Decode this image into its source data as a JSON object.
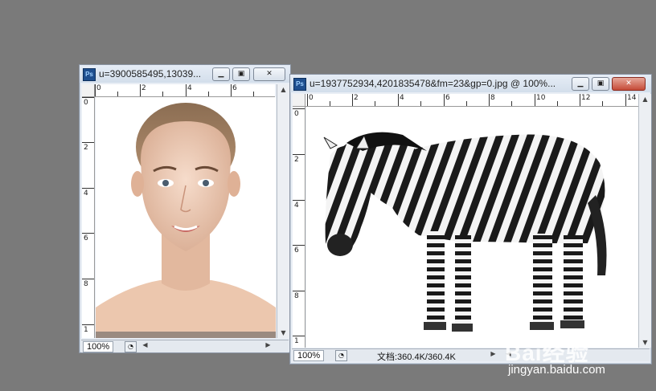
{
  "app": "Photoshop",
  "windows": [
    {
      "icon_label": "Ps",
      "title": "u=3900585495,13039...",
      "zoom": "100%",
      "ruler_h_labels": [
        "0",
        "2",
        "4",
        "6"
      ],
      "ruler_v_labels": [
        "0",
        "2",
        "4",
        "6",
        "8",
        "1"
      ],
      "image_subject": "woman-portrait"
    },
    {
      "icon_label": "Ps",
      "title": "u=1937752934,4201835478&fm=23&gp=0.jpg @ 100%...",
      "zoom": "100%",
      "doc_info": "文档:360.4K/360.4K",
      "ruler_h_labels": [
        "0",
        "2",
        "4",
        "6",
        "8",
        "10",
        "12",
        "14"
      ],
      "ruler_v_labels": [
        "0",
        "2",
        "4",
        "6",
        "8",
        "1"
      ],
      "image_subject": "zebra"
    }
  ],
  "watermark": {
    "brand": "Bai经验",
    "url": "jingyan.baidu.com"
  },
  "colors": {
    "desktop": "#7a7a7a",
    "title_bg": "#dde6f1",
    "close_button": "#c54a37",
    "ps_icon": "#1f4f8f"
  }
}
